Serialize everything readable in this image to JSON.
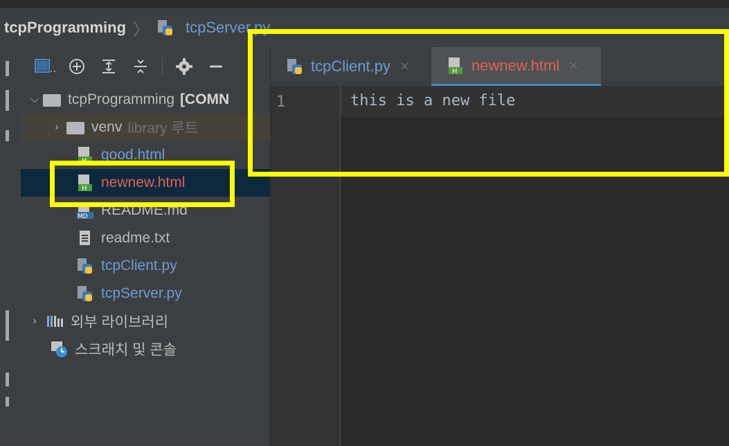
{
  "breadcrumb": {
    "root": "tcpProgramming",
    "file": "tcpServer.py"
  },
  "project": {
    "root_label": "tcpProgramming",
    "root_suffix": "[COMN",
    "items": [
      {
        "label": "venv",
        "note": "library 루트"
      },
      {
        "label": "good.html"
      },
      {
        "label": "newnew.html"
      },
      {
        "label": "README.md"
      },
      {
        "label": "readme.txt"
      },
      {
        "label": "tcpClient.py"
      },
      {
        "label": "tcpServer.py"
      },
      {
        "label": "외부 라이브러리"
      },
      {
        "label": "스크래치 및 콘솔"
      }
    ]
  },
  "tabs": [
    {
      "label": "tcpClient.py",
      "close": "×"
    },
    {
      "label": "newnew.html",
      "close": "×"
    }
  ],
  "editor": {
    "line_number": "1",
    "line_text": "this is a new file"
  },
  "icons": {
    "file_html": "html-file-icon",
    "file_py": "python-file-icon",
    "file_md": "markdown-file-icon",
    "file_txt": "text-file-icon",
    "folder": "folder-icon",
    "library": "library-icon",
    "scratch": "scratch-icon"
  },
  "colors": {
    "highlight": "#ffff00",
    "modified_file": "#e0605a",
    "new_file": "#6a9cd6",
    "selected_row": "#0d293e"
  }
}
